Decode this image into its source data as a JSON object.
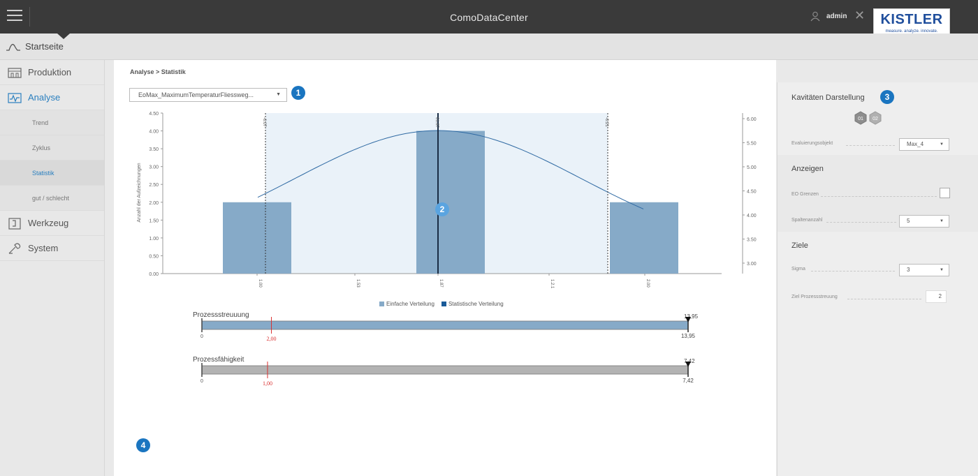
{
  "app": {
    "title": "ComoDataCenter",
    "user": "admin",
    "brand": "KISTLER",
    "brand_tagline": "measure. analyze. innovate."
  },
  "startbar": {
    "label": "Startseite"
  },
  "sidebar": {
    "items": [
      {
        "label": "Produktion",
        "icon": "factory-icon"
      },
      {
        "label": "Analyse",
        "icon": "analysis-icon",
        "active": true
      },
      {
        "label": "Werkzeug",
        "icon": "tool-icon"
      },
      {
        "label": "System",
        "icon": "wrench-icon"
      }
    ],
    "subitems": [
      {
        "label": "Trend"
      },
      {
        "label": "Zyklus"
      },
      {
        "label": "Statistik",
        "active": true
      },
      {
        "label": "gut / schlecht"
      }
    ]
  },
  "main": {
    "breadcrumb": "Analyse > Statistik",
    "dropdown_value": "EoMax_MaximumTemperaturFliessweg...",
    "badges": [
      "1",
      "2",
      "3",
      "4"
    ]
  },
  "chart_data": {
    "type": "bar",
    "ylabel": "Anzahl der Aufzeichnungen",
    "y_ticks": [
      "4.50",
      "4.00",
      "3.50",
      "3.00",
      "2.50",
      "2.00",
      "1.50",
      "1.00",
      "0.50",
      "0.00"
    ],
    "y2_ticks": [
      "6.00",
      "5.50",
      "5.00",
      "4.50",
      "4.00",
      "3.50",
      "3.00"
    ],
    "x_ticks": [
      "1.00",
      "1.53",
      "1.87",
      "1.2.1",
      "2.00"
    ],
    "vline_labels": [
      "-0.07",
      "01.87",
      "-0.21"
    ],
    "bars": [
      {
        "x": 0,
        "value": 2
      },
      {
        "x": 1,
        "value": 4
      },
      {
        "x": 2,
        "value": 2
      }
    ],
    "ylim": [
      0,
      4.5
    ],
    "legend": [
      {
        "name": "Einfache Verteilung",
        "color": "#86aac8"
      },
      {
        "name": "Statistische Verteilung",
        "color": "#1a5a98"
      }
    ]
  },
  "meters": [
    {
      "title": "Prozessstreuuung",
      "min": "0",
      "max_label": "13,95",
      "top_label": "13,95",
      "target_label": "2,00",
      "target_fraction": 0.143,
      "color": "#86aac8"
    },
    {
      "title": "Prozessfähigkeit",
      "min": "0",
      "max_label": "7,42",
      "top_label": "7,42",
      "target_label": "1,00",
      "target_fraction": 0.135,
      "color": "#b3b3b3"
    }
  ],
  "rpanel": {
    "kav_title": "Kavitäten Darstellung",
    "cavities": [
      "01",
      "02"
    ],
    "eval_label": "Evaluierungsobjekt",
    "eval_value": "Max_4",
    "anzeigen_title": "Anzeigen",
    "eo_label": "EO Grenzen",
    "spalten_label": "Spaltenanzahl",
    "spalten_value": "5",
    "ziele_title": "Ziele",
    "sigma_label": "Sigma",
    "sigma_value": "3",
    "ziel_label": "Ziel Prozessstreuung",
    "ziel_value": "2"
  }
}
